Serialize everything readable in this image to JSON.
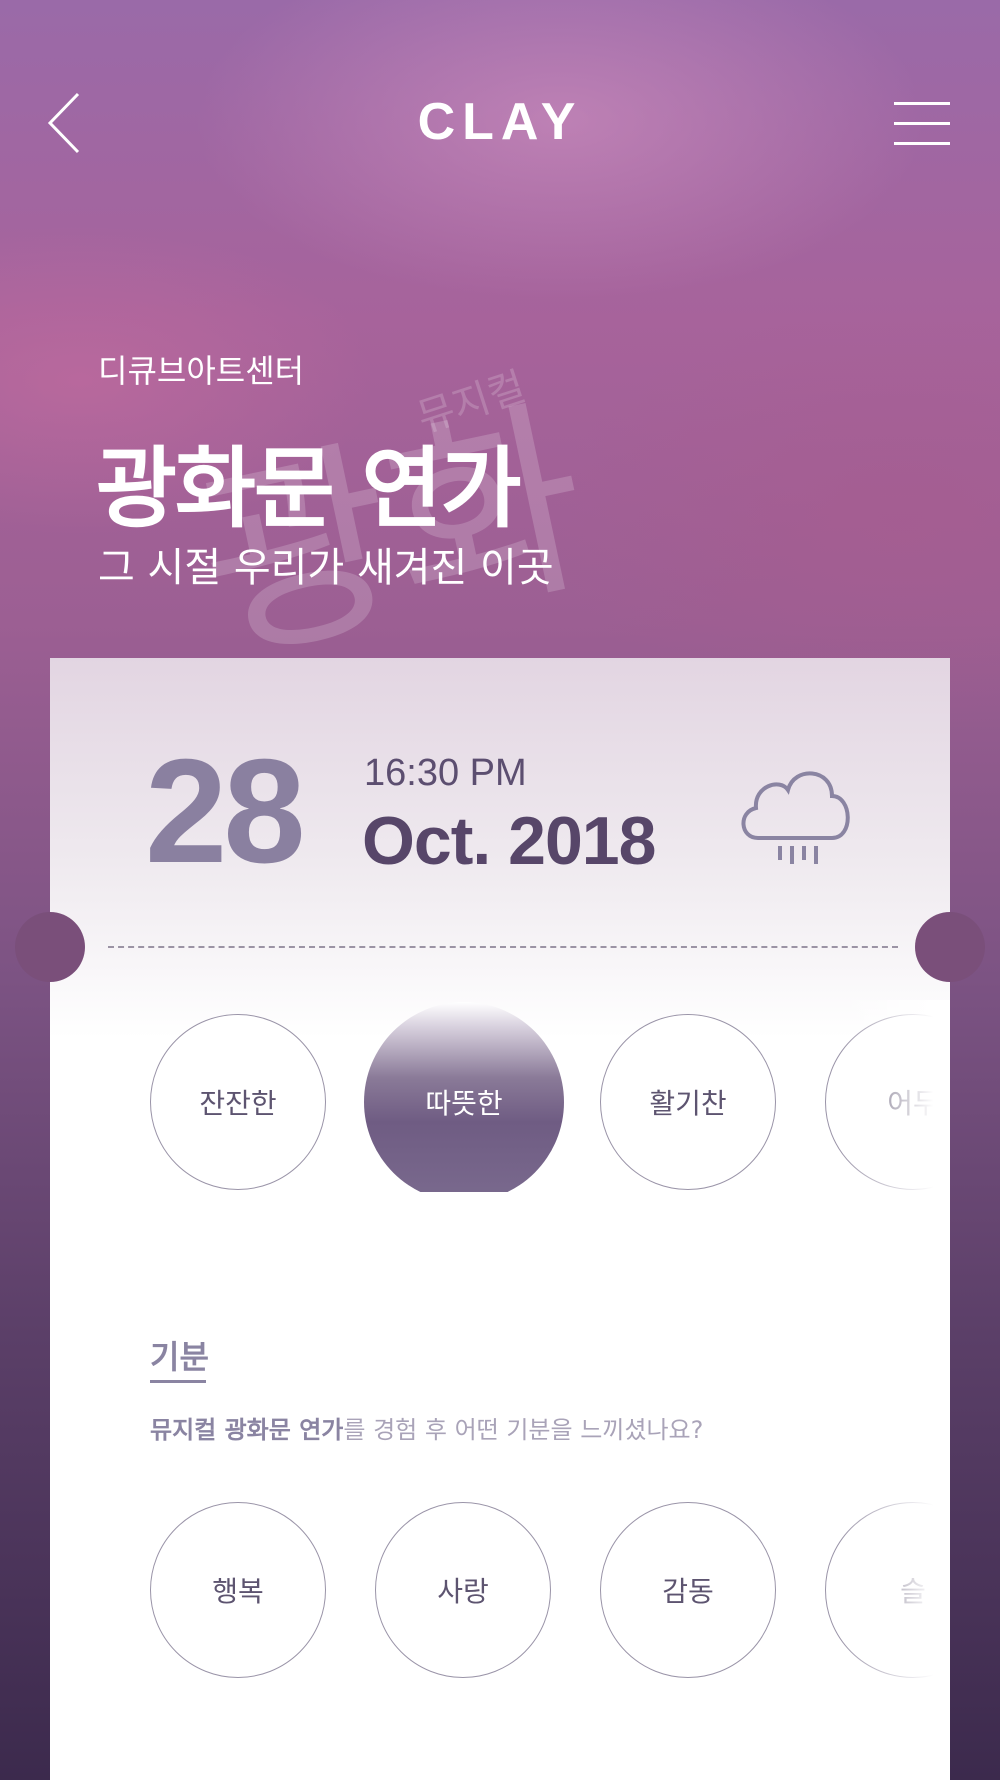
{
  "header": {
    "brand": "CLAY"
  },
  "hero": {
    "venue": "디큐브아트센터",
    "title": "광화문 연가",
    "subtitle": "그 시절 우리가 새겨진 이곳"
  },
  "ticket": {
    "day": "28",
    "time": "16:30 PM",
    "month_year": "Oct. 2018",
    "weather_icon": "rain-cloud-icon"
  },
  "tone_chips": [
    {
      "label": "잔잔한",
      "selected": false
    },
    {
      "label": "따뜻한",
      "selected": true
    },
    {
      "label": "활기찬",
      "selected": false
    },
    {
      "label": "어두",
      "selected": false
    }
  ],
  "mood_section": {
    "label": "기분",
    "question_highlight": "뮤지컬 광화문 연가",
    "question_rest": "를 경험 후 어떤 기분을 느끼셨나요?"
  },
  "mood_chips": [
    {
      "label": "행복"
    },
    {
      "label": "사랑"
    },
    {
      "label": "감동"
    },
    {
      "label": "슬"
    }
  ],
  "colors": {
    "accent": "#8a84a2",
    "selected_chip": "#6f5c83",
    "date_text": "#574669"
  }
}
